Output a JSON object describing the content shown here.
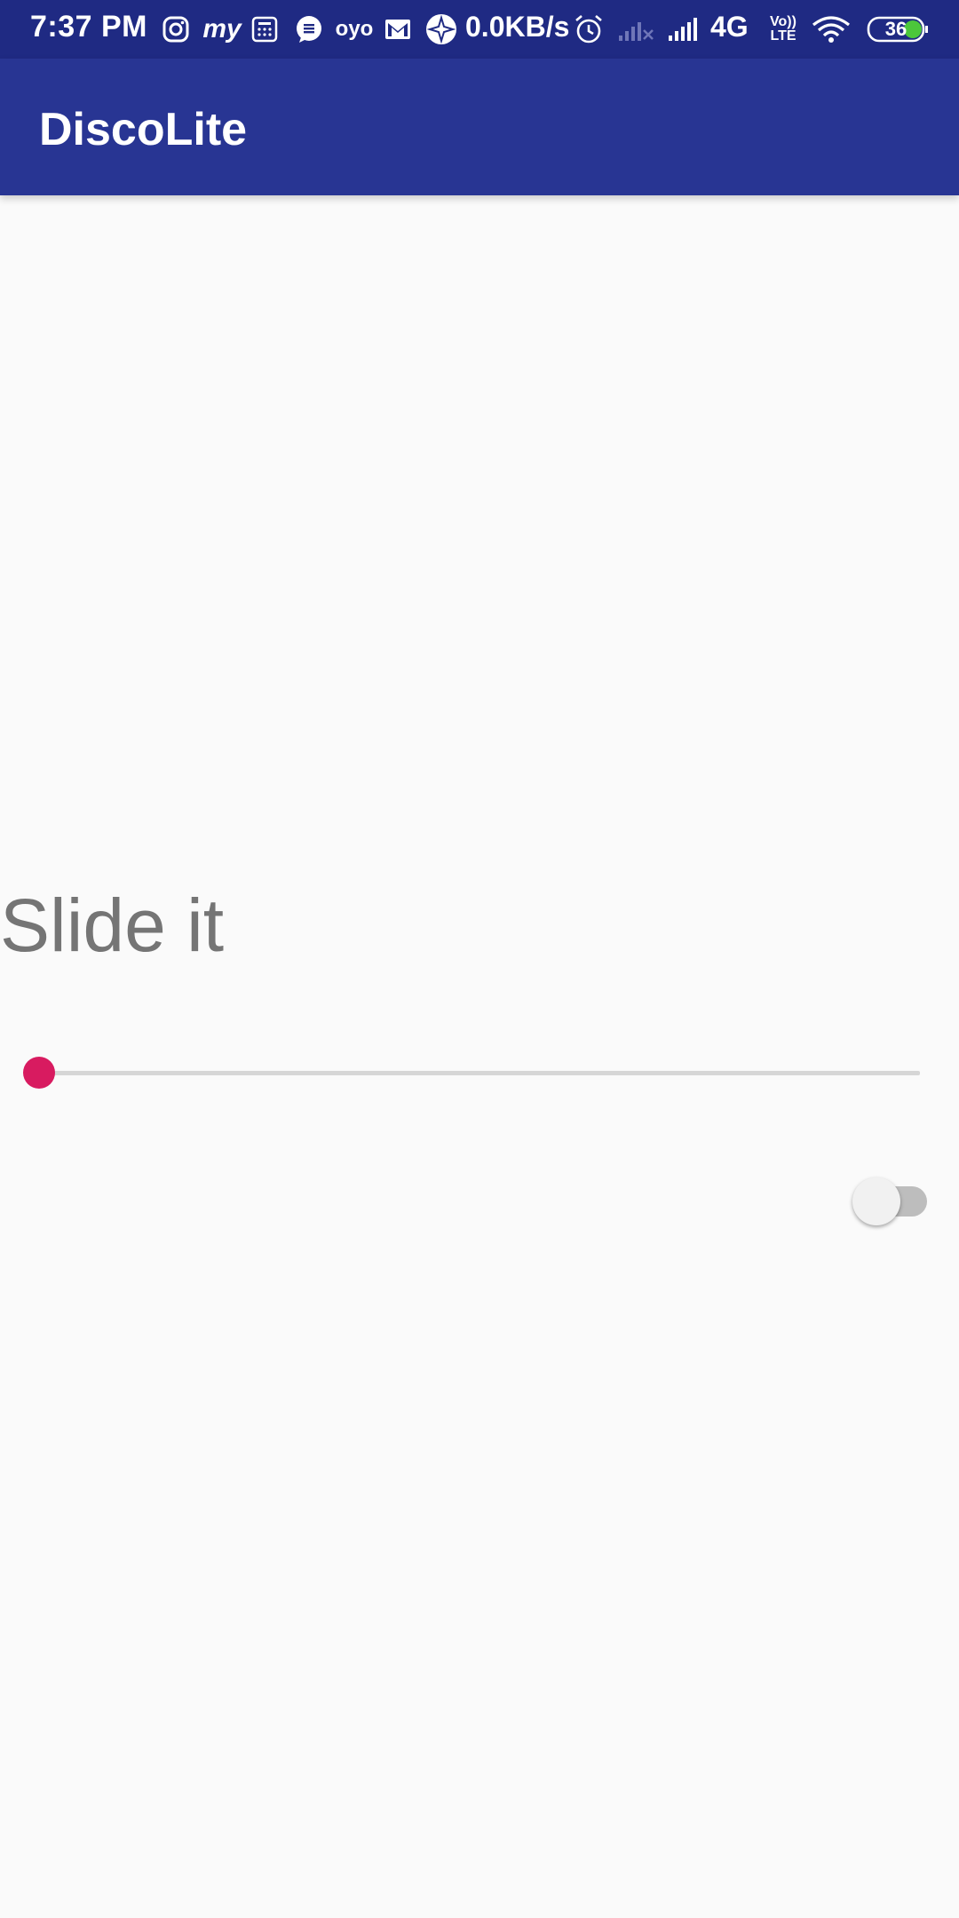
{
  "status_bar": {
    "time": "7:37 PM",
    "network_speed": "0.0KB/s",
    "network_type": "4G",
    "volte_line1": "Vo))",
    "volte_line2": "LTE",
    "battery_level": "36",
    "icons": [
      "instagram-icon",
      "myntra-icon",
      "calculator-icon",
      "messages-icon",
      "oyo-icon",
      "gmail-icon",
      "compass-icon",
      "alarm-icon",
      "signal-x-icon",
      "signal-icon",
      "wifi-icon",
      "battery-icon"
    ],
    "notification_texts": {
      "myntra": "my",
      "oyo": "oyo"
    }
  },
  "app_bar": {
    "title": "DiscoLite"
  },
  "main": {
    "label": "Slide it",
    "slider": {
      "value_fraction": 0.0
    },
    "switch": {
      "checked": false
    }
  },
  "colors": {
    "status_bar": "#1f2a83",
    "app_bar": "#283593",
    "accent": "#d81b60",
    "background": "#fafafa",
    "label_text": "#757575"
  }
}
